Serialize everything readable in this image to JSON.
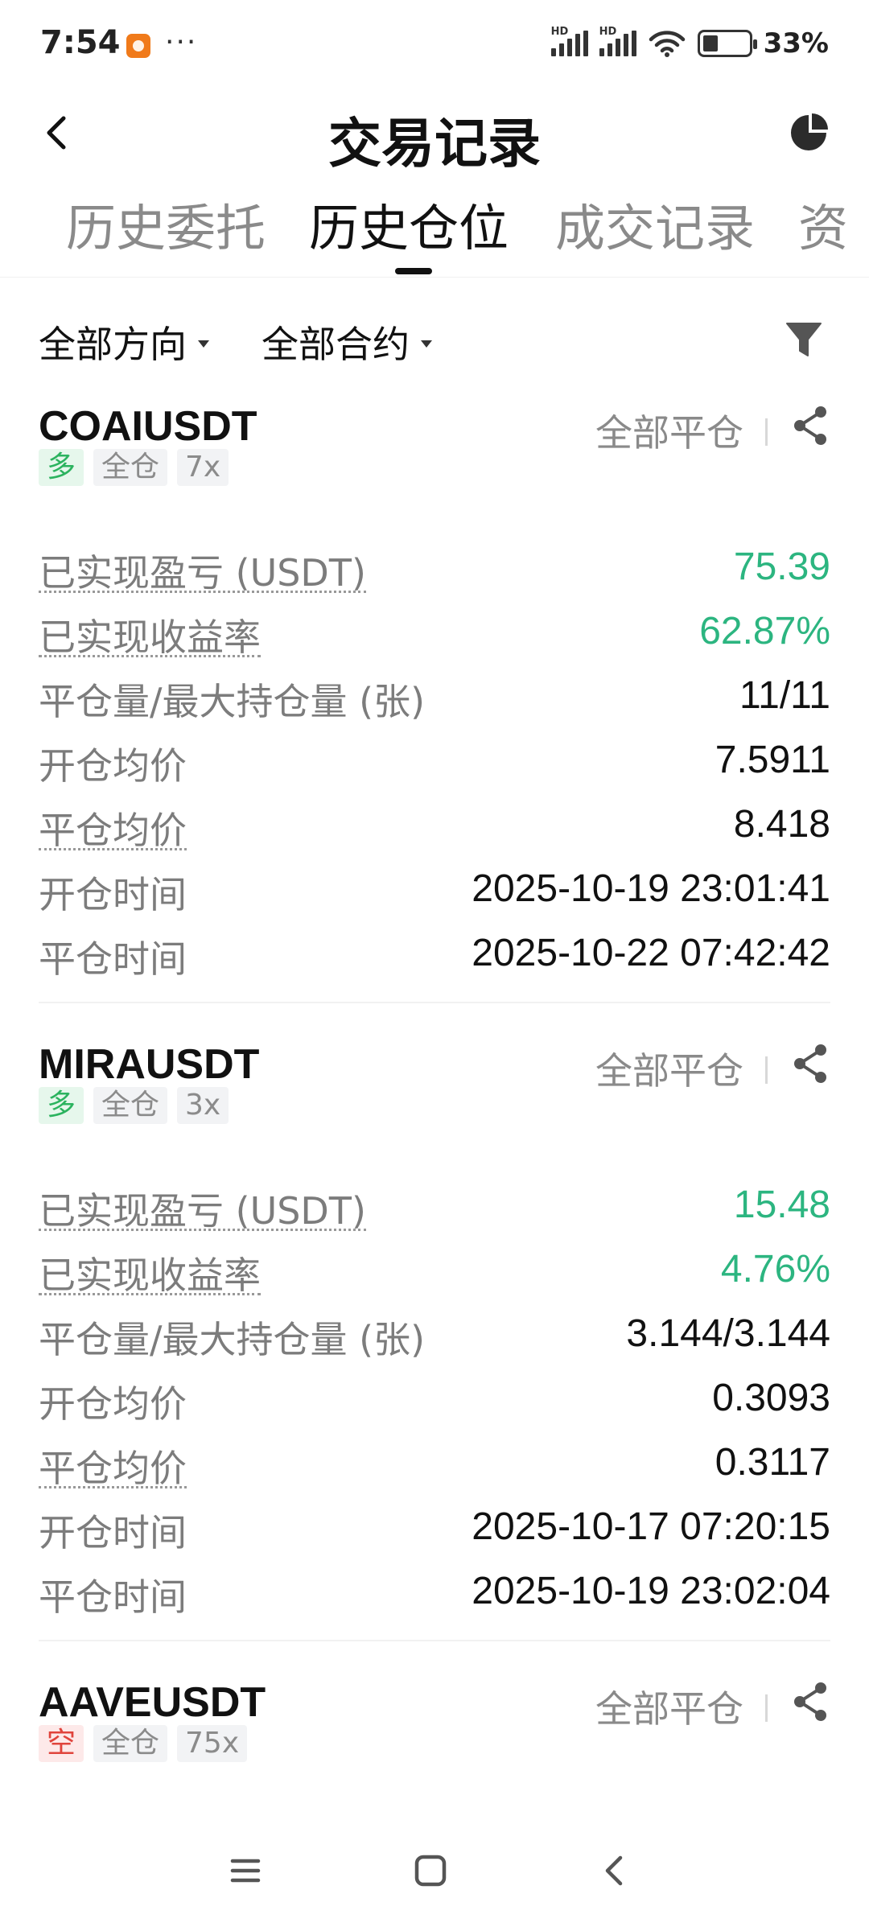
{
  "status_bar": {
    "time": "7:54",
    "dots": "···",
    "battery_text": "33%",
    "battery_level": 0.33
  },
  "header": {
    "title": "交易记录",
    "back_icon": "chevron-left-icon",
    "right_icon": "pie-chart-icon"
  },
  "tabs": [
    {
      "label": "历史委托",
      "active": false
    },
    {
      "label": "历史仓位",
      "active": true
    },
    {
      "label": "成交记录",
      "active": false
    },
    {
      "label": "资",
      "active": false
    }
  ],
  "filters": {
    "direction": "全部方向",
    "contract": "全部合约",
    "filter_icon": "funnel-icon"
  },
  "positions": [
    {
      "symbol": "COAIUSDT",
      "side": "多",
      "margin_mode": "全仓",
      "leverage": "7x",
      "close_type": "全部平仓",
      "rows": [
        {
          "label": "已实现盈亏 (USDT)",
          "value": "75.39"
        },
        {
          "label": "已实现收益率",
          "value": "62.87%"
        },
        {
          "label": "平仓量/最大持仓量 (张)",
          "value": "11/11"
        },
        {
          "label": "开仓均价",
          "value": "7.5911"
        },
        {
          "label": "平仓均价",
          "value": "8.418"
        },
        {
          "label": "开仓时间",
          "value": "2025-10-19 23:01:41"
        },
        {
          "label": "平仓时间",
          "value": "2025-10-22 07:42:42"
        }
      ]
    },
    {
      "symbol": "MIRAUSDT",
      "side": "多",
      "margin_mode": "全仓",
      "leverage": "3x",
      "close_type": "全部平仓",
      "rows": [
        {
          "label": "已实现盈亏 (USDT)",
          "value": "15.48"
        },
        {
          "label": "已实现收益率",
          "value": "4.76%"
        },
        {
          "label": "平仓量/最大持仓量 (张)",
          "value": "3.144/3.144"
        },
        {
          "label": "开仓均价",
          "value": "0.3093"
        },
        {
          "label": "平仓均价",
          "value": "0.3117"
        },
        {
          "label": "开仓时间",
          "value": "2025-10-17 07:20:15"
        },
        {
          "label": "平仓时间",
          "value": "2025-10-19 23:02:04"
        }
      ]
    },
    {
      "symbol": "AAVEUSDT",
      "side": "空",
      "margin_mode": "全仓",
      "leverage": "75x",
      "close_type": "全部平仓"
    }
  ],
  "colors": {
    "profit_green": "#2cb580",
    "long_green": "#2cb35f",
    "short_red": "#e0443c",
    "muted_gray": "#8a8a8a"
  },
  "navbar": {
    "menu_icon": "menu-icon",
    "home_icon": "home-square-icon",
    "back_icon": "back-chevron-icon"
  }
}
